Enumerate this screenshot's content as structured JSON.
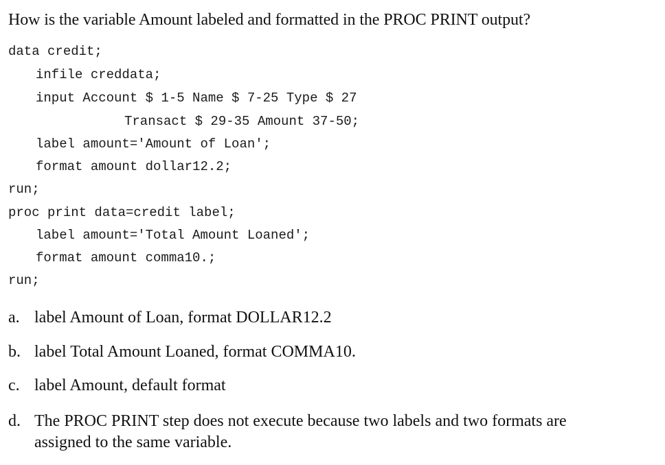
{
  "question": "How is the variable Amount labeled and formatted in the PROC PRINT output?",
  "code": {
    "lines": [
      "data credit;",
      "infile creddata;",
      "input Account $ 1-5 Name $ 7-25 Type $ 27",
      "Transact $ 29-35 Amount 37-50;",
      "label amount='Amount of Loan';",
      "format amount dollar12.2;",
      "run;",
      "proc print data=credit label;",
      "label amount='Total Amount Loaned';",
      "format amount comma10.;",
      "run;"
    ]
  },
  "options": [
    {
      "letter": "a.",
      "text": "label Amount of Loan, format DOLLAR12.2"
    },
    {
      "letter": "b.",
      "text": "label Total Amount Loaned, format COMMA10."
    },
    {
      "letter": "c.",
      "text": "label Amount, default format"
    },
    {
      "letter": "d.",
      "text": "The PROC PRINT step does not execute because two labels and two formats are",
      "continuation": "assigned to the same variable."
    }
  ]
}
